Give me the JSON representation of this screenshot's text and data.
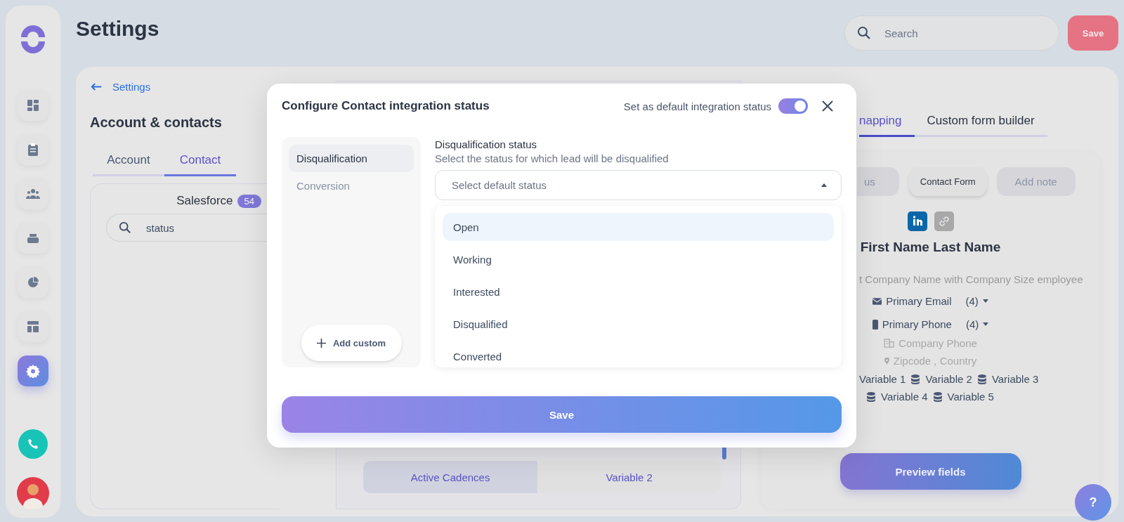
{
  "sidebar": {
    "nav_items": [
      {
        "selected": false
      },
      {
        "selected": false
      },
      {
        "selected": false
      },
      {
        "selected": false
      },
      {
        "selected": false
      },
      {
        "selected": false
      },
      {
        "selected": true
      }
    ]
  },
  "header": {
    "title": "Settings",
    "search": {
      "placeholder": "Search"
    },
    "save": "Save"
  },
  "left": {
    "back_link": "Settings",
    "title": "Account & contacts",
    "tabs": [
      {
        "label": "Account",
        "selected": false
      },
      {
        "label": "Contact",
        "selected": true
      }
    ],
    "integration": {
      "name": "Salesforce",
      "count": "54",
      "search_value": "status"
    }
  },
  "middle": {
    "row": [
      "Active Cadences",
      "Variable 2"
    ]
  },
  "right": {
    "tabs": [
      {
        "label": "napping",
        "selected": true
      },
      {
        "label": "Custom form builder",
        "selected": false
      }
    ],
    "buttons": [
      {
        "label": "us",
        "selected": false
      },
      {
        "label": "Contact Form",
        "selected": true
      },
      {
        "label": "Add note",
        "selected": false
      }
    ],
    "preview": {
      "name": "First Name Last Name",
      "company": "t Company Name with Company Size employee",
      "fields": [
        {
          "kind": "email",
          "label": "Primary Email",
          "count": "(4)"
        },
        {
          "kind": "phone",
          "label": "Primary Phone",
          "count": "(4)"
        }
      ],
      "company_phone": "Company Phone",
      "location": "Zipcode , Country",
      "variable_lines": [
        [
          {
            "label": "Variable 1",
            "icon": false
          },
          {
            "label": "Variable 2",
            "icon": true
          },
          {
            "label": "Variable 3",
            "icon": true
          }
        ],
        [
          {
            "label": "Variable 4",
            "icon": true
          },
          {
            "label": "Variable 5",
            "icon": true
          }
        ]
      ]
    },
    "preview_button": "Preview fields"
  },
  "help": "?",
  "modal": {
    "title": "Configure Contact integration status",
    "default_toggle": {
      "label": "Set as default integration status",
      "on": true
    },
    "nav": [
      {
        "label": "Disqualification",
        "selected": true
      },
      {
        "label": "Conversion",
        "selected": false
      }
    ],
    "add_custom": "Add custom",
    "field_title": "Disqualification status",
    "field_hint": "Select the status for which lead will be disqualified",
    "select": {
      "placeholder": "Select default status",
      "expanded": true
    },
    "options": [
      {
        "label": "Open",
        "selected": true
      },
      {
        "label": "Working",
        "selected": false
      },
      {
        "label": "Interested",
        "selected": false
      },
      {
        "label": "Disqualified",
        "selected": false
      },
      {
        "label": "Converted",
        "selected": false
      }
    ],
    "save": "Save"
  }
}
